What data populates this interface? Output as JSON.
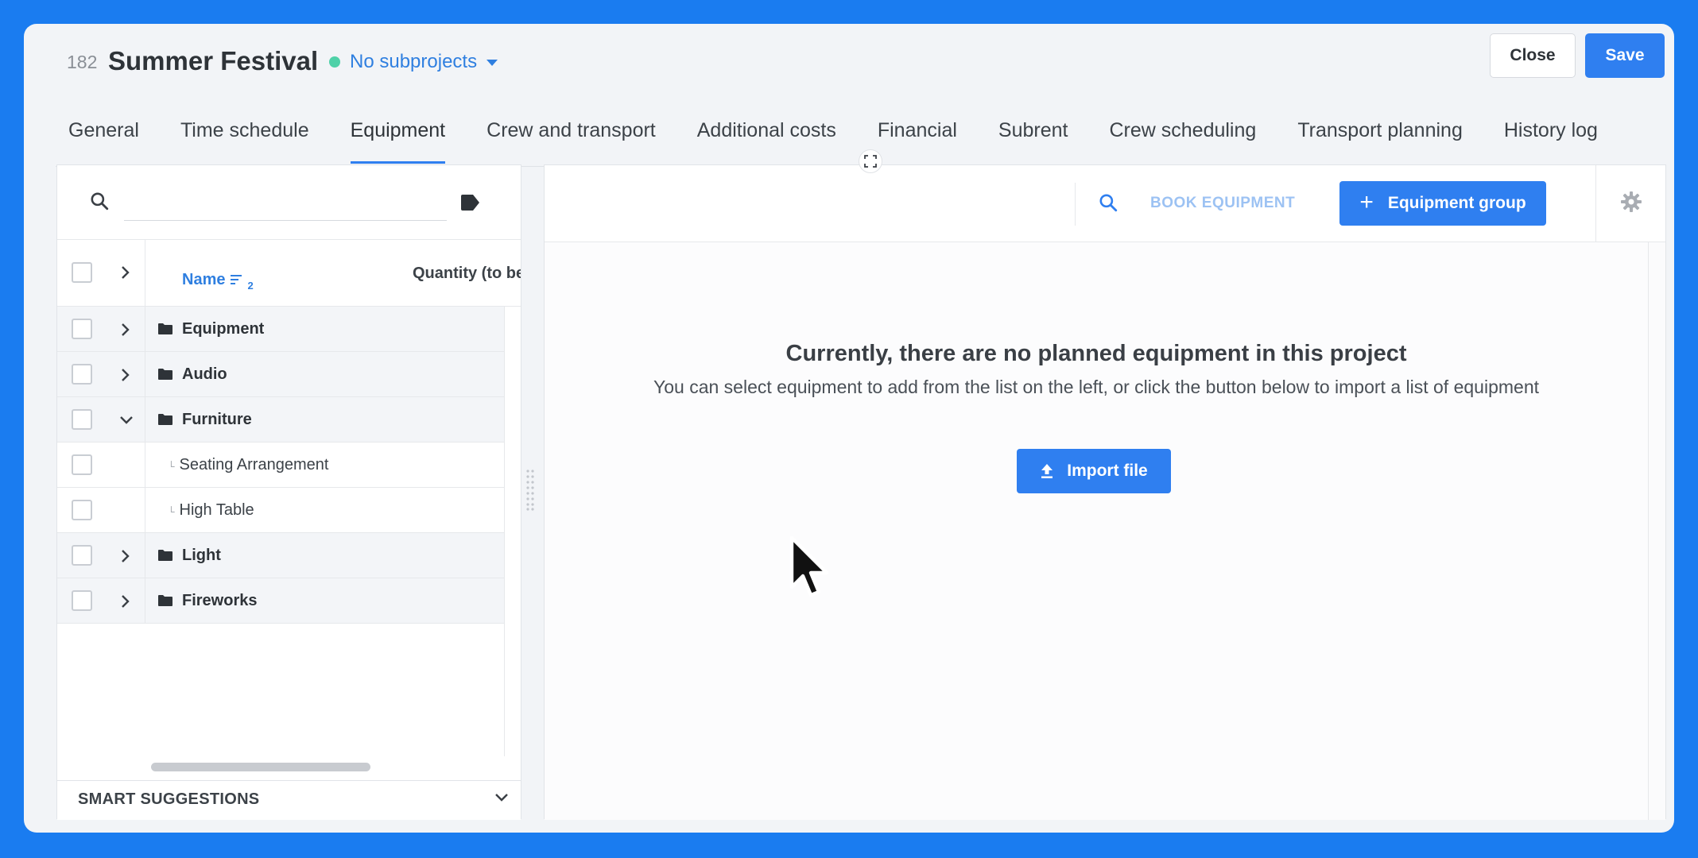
{
  "project": {
    "number": "182",
    "title": "Summer Festival",
    "subprojects_label": "No subprojects",
    "status_color": "#4fd1a8"
  },
  "actions": {
    "close_label": "Close",
    "save_label": "Save"
  },
  "tabs": [
    {
      "label": "General"
    },
    {
      "label": "Time schedule"
    },
    {
      "label": "Equipment",
      "active": true
    },
    {
      "label": "Crew and transport"
    },
    {
      "label": "Additional costs"
    },
    {
      "label": "Financial"
    },
    {
      "label": "Subrent"
    },
    {
      "label": "Crew scheduling"
    },
    {
      "label": "Transport planning"
    },
    {
      "label": "History log"
    }
  ],
  "left_panel": {
    "search": {
      "placeholder": "",
      "value": ""
    },
    "columns": {
      "name": "Name",
      "sort_index": "2",
      "quantity": "Quantity (to be pla"
    },
    "rows": [
      {
        "label": "Equipment",
        "type": "group",
        "expanded": false
      },
      {
        "label": "Audio",
        "type": "group",
        "expanded": false
      },
      {
        "label": "Furniture",
        "type": "group",
        "expanded": true
      },
      {
        "label": "Seating Arrangement",
        "type": "child"
      },
      {
        "label": "High Table",
        "type": "child"
      },
      {
        "label": "Light",
        "type": "group",
        "expanded": false
      },
      {
        "label": "Fireworks",
        "type": "group",
        "expanded": false
      }
    ],
    "smart_suggestions_label": "SMART SUGGESTIONS"
  },
  "right_panel": {
    "book_label": "BOOK EQUIPMENT",
    "group_button_label": "Equipment group",
    "empty_title": "Currently, there are no planned equipment in this project",
    "empty_subtitle": "You can select equipment to add from the list on the left, or click the button below to import a list of equipment",
    "import_label": "Import file"
  },
  "colors": {
    "accent": "#2f7ff0",
    "background": "#1a7cf0",
    "link": "#2f7fe0"
  },
  "icons": [
    "search-icon",
    "tag-icon",
    "chevron-right-icon",
    "chevron-down-icon",
    "folder-icon",
    "sort-icon",
    "plus-icon",
    "more-vertical-icon",
    "gear-icon",
    "upload-icon",
    "expand-icon",
    "drag-handle-icon",
    "mouse-cursor"
  ]
}
